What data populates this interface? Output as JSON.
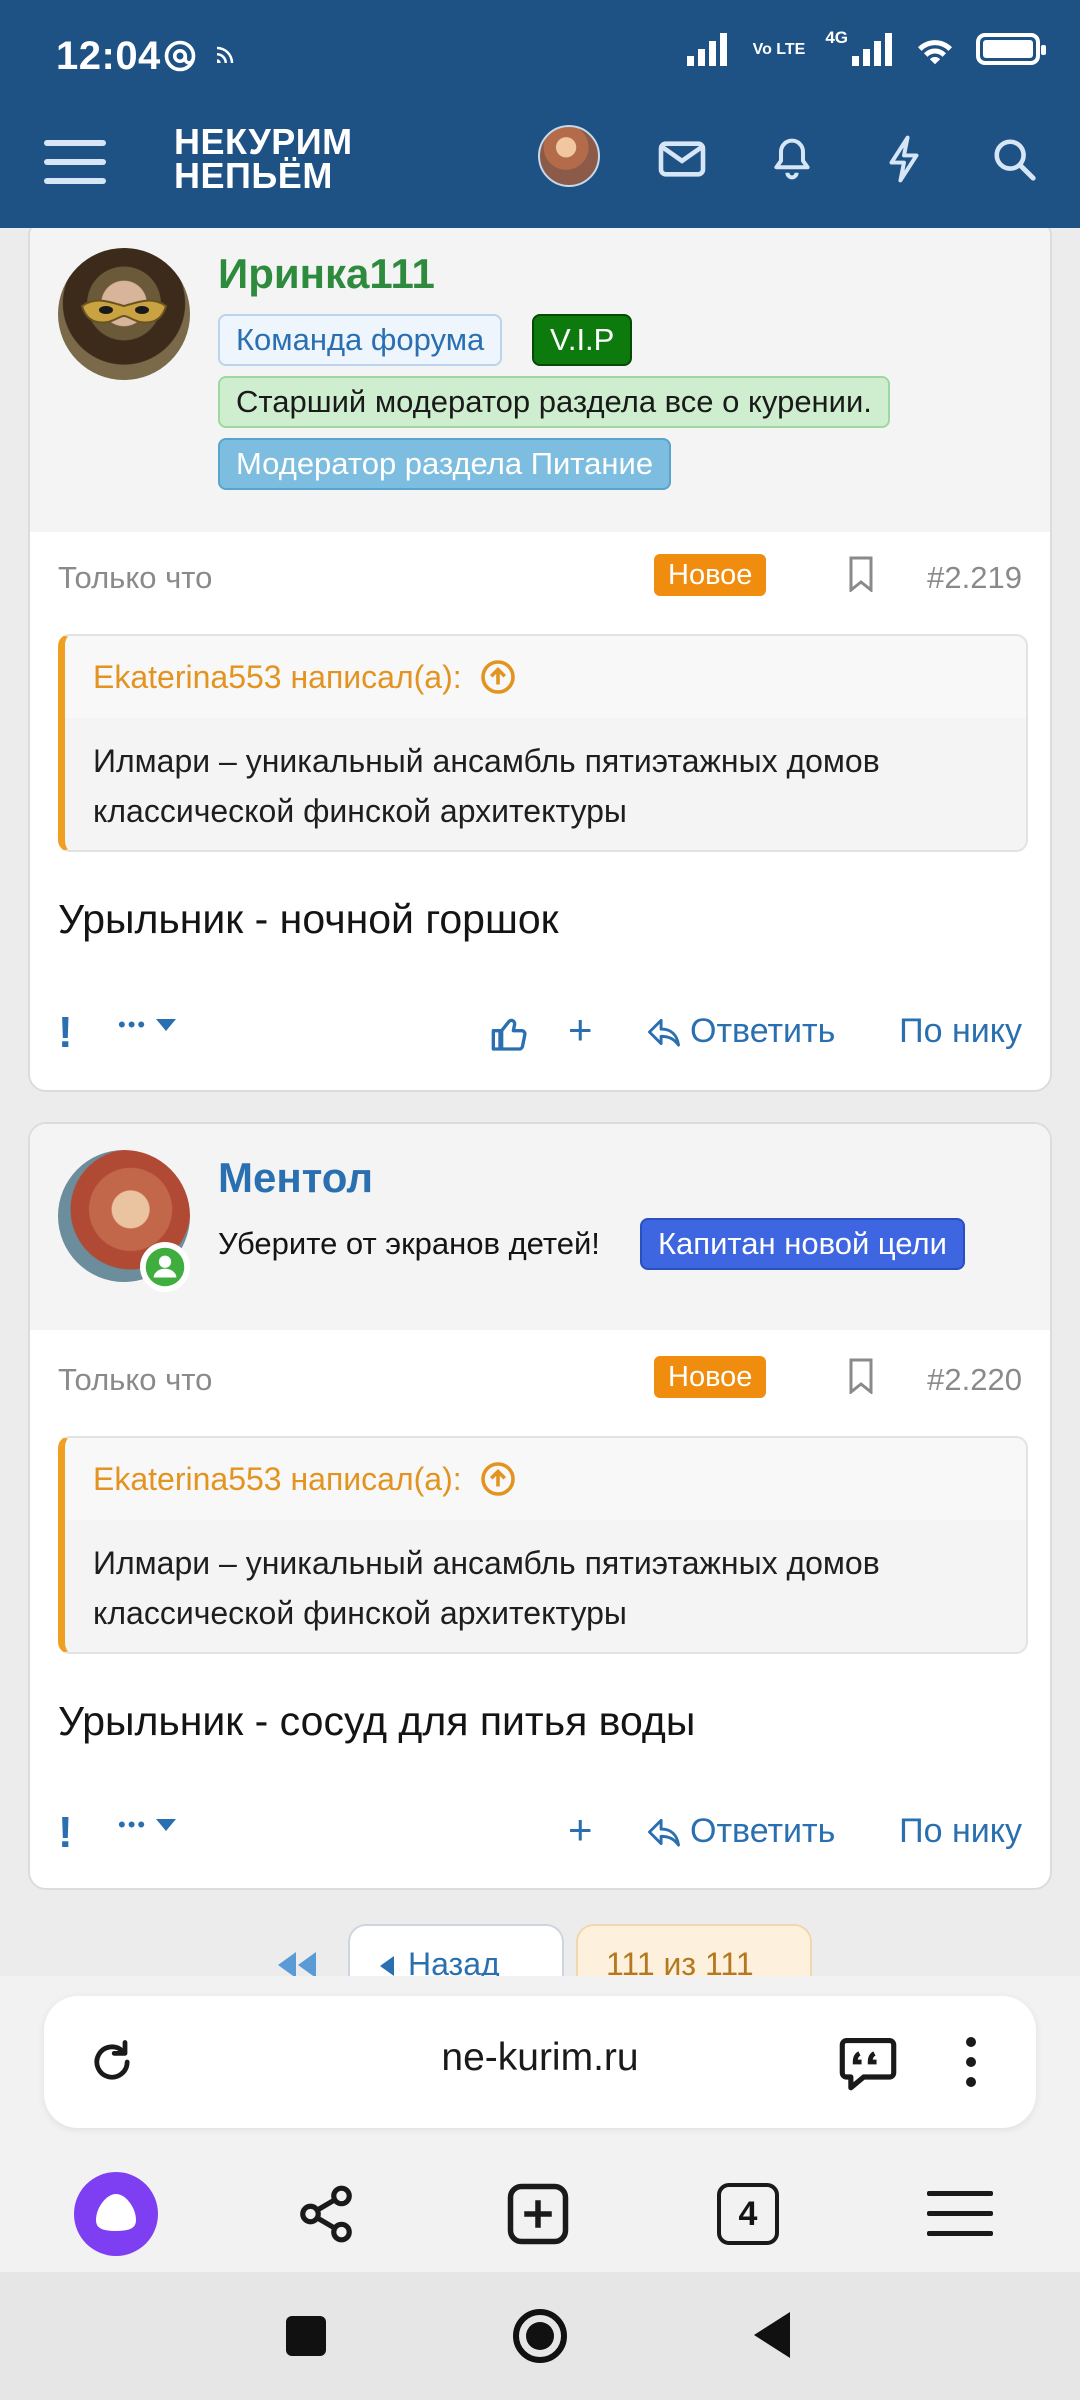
{
  "status_bar": {
    "time": "12:04",
    "network": "4G",
    "volte": "Vo LTE"
  },
  "header": {
    "logo_line1": "НЕКУРИМ",
    "logo_line2": "НЕПЬЁМ",
    "brand_color": "#1e5285"
  },
  "posts": [
    {
      "username": "Иринка111",
      "username_color": "#2e8b3e",
      "badges": [
        "Команда форума",
        "V.I.P",
        "Старший модератор раздела все о курении.",
        "Модератор раздела Питание"
      ],
      "time": "Только что",
      "new_label": "Новое",
      "post_number": "#2.219",
      "quote_author": "Ekaterina553 написал(а):",
      "quote_text": "Илмари – уникальный ансамбль пятиэтажных домов классической финской архитектуры",
      "message": "Урыльник - ночной горшок",
      "actions": {
        "flag": "!",
        "more": "•••",
        "reply": "Ответить",
        "nick": "По нику",
        "plus": "+"
      }
    },
    {
      "username": "Ментол",
      "username_color": "#2a6fb0",
      "subtitle": "Уберите от экранов детей!",
      "badges": [
        "Капитан новой цели"
      ],
      "time": "Только что",
      "new_label": "Новое",
      "post_number": "#2.220",
      "quote_author": "Ekaterina553 написал(а):",
      "quote_text": "Илмари – уникальный ансамбль пятиэтажных домов классической финской архитектуры",
      "message": "Урыльник - сосуд для питья воды",
      "actions": {
        "flag": "!",
        "more": "•••",
        "reply": "Ответить",
        "nick": "По нику",
        "plus": "+"
      }
    }
  ],
  "pager": {
    "back": "Назад",
    "current": "111 из 111"
  },
  "browser": {
    "url": "ne-kurim.ru",
    "tabs_count": "4"
  }
}
